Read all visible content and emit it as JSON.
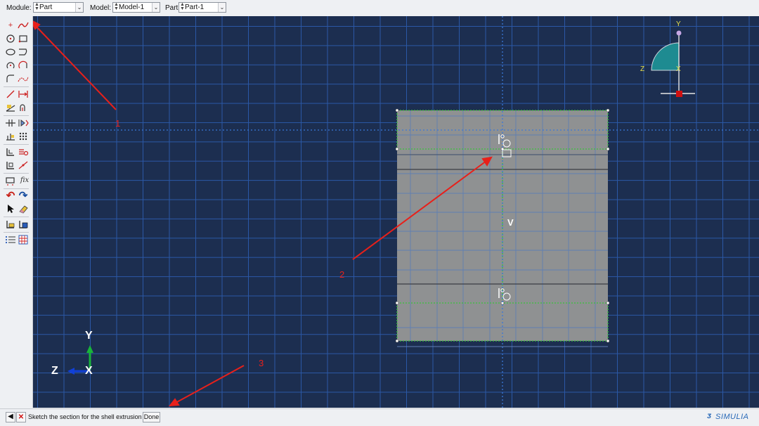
{
  "context_bar": {
    "module_label": "Module:",
    "module_value": "Part",
    "model_label": "Model:",
    "model_value": "Model-1",
    "part_label": "Part:",
    "part_value": "Part-1"
  },
  "toolbox": {
    "tools": [
      "create-isolated-point-icon",
      "create-spline-icon",
      "create-circle-icon",
      "create-rectangle-icon",
      "create-ellipse-icon",
      "create-line-icon",
      "create-arc-center-icon",
      "create-arc-tangent-icon",
      "create-fillet-icon",
      "create-construction-spline-icon",
      "create-construction-line-icon",
      "create-dimension-icon",
      "edit-dimension-icon",
      "auto-trim-icon",
      "offset-icon",
      "mirror-icon",
      "copy-icon",
      "grid-pattern-icon",
      "create-reference-icon",
      "linear-pattern-icon",
      "translate-icon",
      "construction-point-icon",
      "add-constraint-icon",
      "fix-constraint-icon",
      "undo-icon",
      "redo-icon",
      "select-icon",
      "eraser-icon",
      "save-sketch-icon",
      "retrieve-sketch-icon",
      "sketch-options-icon",
      "grid-icon"
    ],
    "fix_label": "fix",
    "colors": {
      "undo": "#c8221a",
      "redo": "#1a4fa0",
      "red": "#cc2222",
      "blue": "#2a5cb8"
    }
  },
  "viewport": {
    "center_label": "V",
    "triad_top": {
      "y": "Y",
      "z": "Z",
      "x": "X"
    },
    "triad_bottom": {
      "y": "Y",
      "z": "Z",
      "x": "X"
    },
    "annotations": [
      "1",
      "2",
      "3"
    ],
    "colors": {
      "background": "#1c2e50",
      "grid": "#2b58a6",
      "part_fill": "#8f9192",
      "construction_line": "#3a78d8",
      "selected_edge": "#39c23b",
      "annotation": "#e8201a"
    }
  },
  "prompt": {
    "back_icon": "arrow-left-icon",
    "cancel_icon": "cancel-x-icon",
    "message": "Sketch the section for the shell extrusion",
    "done_label": "Done",
    "brand": "SIMULIA"
  }
}
